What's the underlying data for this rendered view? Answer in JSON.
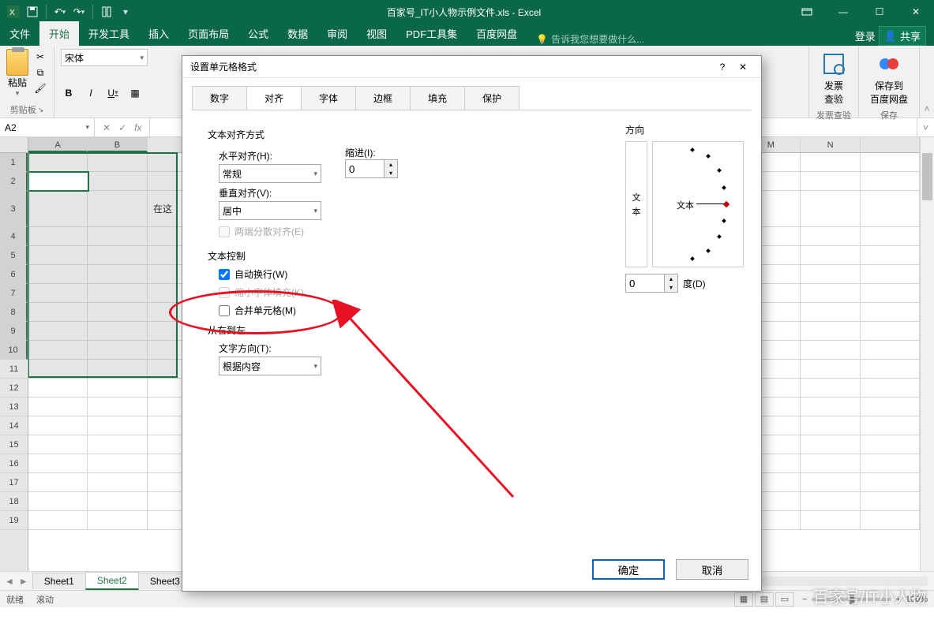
{
  "titlebar": {
    "title": "百家号_IT小人物示例文件.xls - Excel"
  },
  "ribbonTabs": {
    "file": "文件",
    "home": "开始",
    "dev": "开发工具",
    "insert": "插入",
    "layout": "页面布局",
    "formula": "公式",
    "data": "数据",
    "review": "审阅",
    "view": "视图",
    "pdf": "PDF工具集",
    "baidu": "百度网盘",
    "tellme": "告诉我您想要做什么...",
    "login": "登录",
    "share": "共享"
  },
  "ribbon": {
    "paste": "粘贴",
    "clipboard": "剪贴板",
    "fontName": "宋体",
    "bold": "B",
    "italic": "I",
    "underline": "U",
    "invoice": "发票\n查验",
    "baidupan": "保存到\n百度网盘",
    "invoiceGroup": "发票查验",
    "saveGroup": "保存"
  },
  "formulaBar": {
    "cellRef": "A2",
    "fx": "fx"
  },
  "sheet": {
    "cols": [
      "A",
      "B",
      "",
      "",
      "",
      "",
      "",
      "",
      "",
      "",
      "",
      "",
      "M",
      "N"
    ],
    "cellText": "在这",
    "tabs": [
      "Sheet1",
      "Sheet2",
      "Sheet3"
    ],
    "activeTab": 1
  },
  "statusbar": {
    "ready": "就绪",
    "scroll": "滚动",
    "zoom": "100%"
  },
  "dialog": {
    "title": "设置单元格格式",
    "tabs": [
      "数字",
      "对齐",
      "字体",
      "边框",
      "填充",
      "保护"
    ],
    "activeTab": 1,
    "textAlign": {
      "section": "文本对齐方式",
      "hLabel": "水平对齐(H):",
      "hValue": "常规",
      "vLabel": "垂直对齐(V):",
      "vValue": "居中",
      "justify": "两端分散对齐(E)",
      "indentLabel": "缩进(I):",
      "indentValue": "0"
    },
    "textControl": {
      "section": "文本控制",
      "wrap": "自动换行(W)",
      "shrink": "缩小字体填充(K)",
      "merge": "合并单元格(M)"
    },
    "rtl": {
      "section": "从右到左",
      "dirLabel": "文字方向(T):",
      "dirValue": "根据内容"
    },
    "orient": {
      "section": "方向",
      "vtext1": "文",
      "vtext2": "本",
      "htext": "文本",
      "degValue": "0",
      "degLabel": "度(D)"
    },
    "ok": "确定",
    "cancel": "取消"
  },
  "watermark": "百家号/IT小人物"
}
